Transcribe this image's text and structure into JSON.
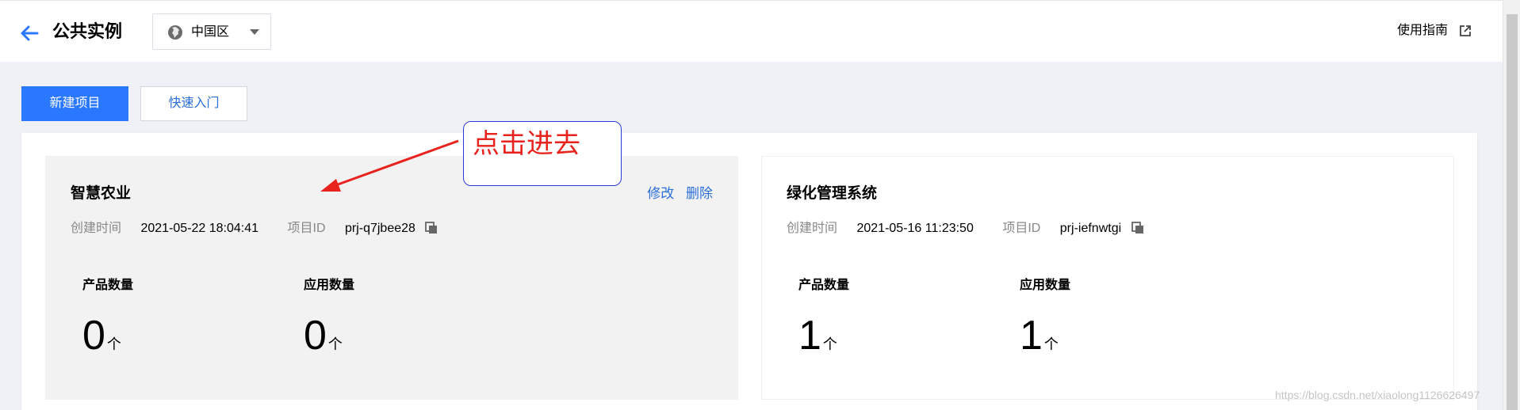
{
  "header": {
    "title": "公共实例",
    "region": "中国区",
    "guide_label": "使用指南"
  },
  "toolbar": {
    "new_project_label": "新建项目",
    "quick_start_label": "快速入门"
  },
  "projects": [
    {
      "name": "智慧农业",
      "created_label": "创建时间",
      "created_value": "2021-05-22 18:04:41",
      "id_label": "项目ID",
      "id_value": "prj-q7jbee28",
      "edit_label": "修改",
      "delete_label": "删除",
      "product_count_label": "产品数量",
      "product_count": "0",
      "app_count_label": "应用数量",
      "app_count": "0",
      "unit": "个",
      "highlighted": true
    },
    {
      "name": "绿化管理系统",
      "created_label": "创建时间",
      "created_value": "2021-05-16 11:23:50",
      "id_label": "项目ID",
      "id_value": "prj-iefnwtgi",
      "product_count_label": "产品数量",
      "product_count": "1",
      "app_count_label": "应用数量",
      "app_count": "1",
      "unit": "个",
      "highlighted": false
    }
  ],
  "annotation": {
    "text": "点击进去",
    "color": "#e8231e"
  },
  "watermark": "https://blog.csdn.net/xiaolong1126626497",
  "colors": {
    "primary": "#2a78ff",
    "link": "#2a6ed8",
    "annotation": "#e8231e"
  },
  "icons": {
    "back": "arrow-left-icon",
    "region": "globe-icon",
    "dropdown": "caret-down-icon",
    "external": "external-link-icon",
    "copy": "copy-icon"
  }
}
